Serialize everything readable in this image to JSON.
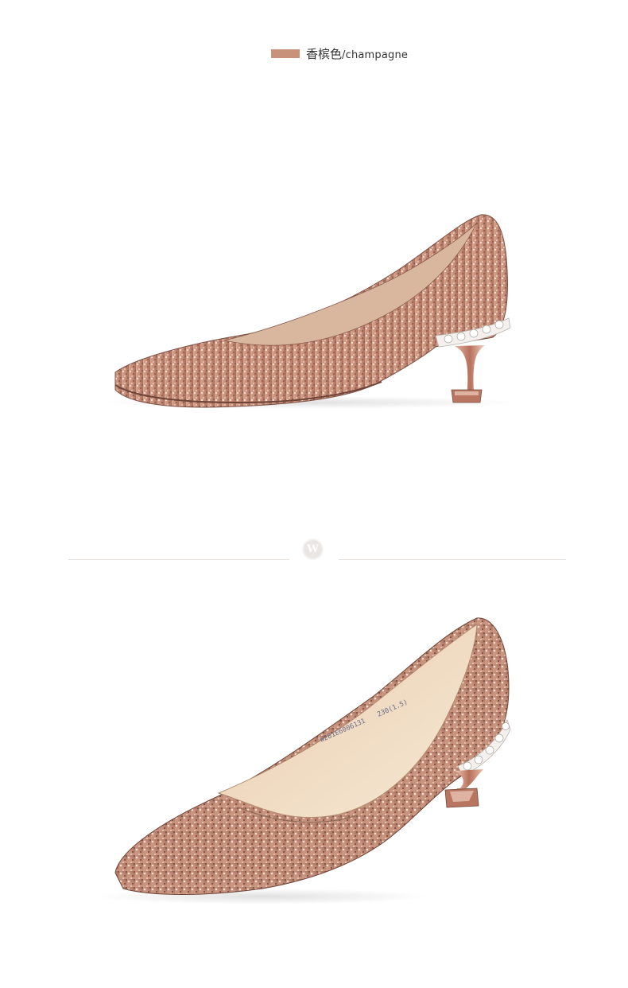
{
  "color_option": {
    "swatch_color": "#c8917a",
    "name_cn": "香槟色",
    "separator": "/",
    "name_en": "champagne"
  },
  "photos": [
    {
      "subject": "champagne glitter pointed-toe pump, side view",
      "icon": "shoe-side-image"
    },
    {
      "subject": "champagne glitter pointed-toe pump, three-quarter view",
      "icon": "shoe-angle-image"
    }
  ],
  "insole_print": {
    "line1": "W281E6006131",
    "line2": "230(1.5)"
  },
  "divider": {
    "logo_letter": "W",
    "logo_color": "#e9e6e3",
    "line_color": "#e6e1dc"
  },
  "colors": {
    "glitter_light": "#e9c4b2",
    "glitter_mid": "#c8917a",
    "glitter_dark": "#8a5a4b",
    "lining": "#e8d2b4",
    "heel_metal": "#c98f7a"
  }
}
